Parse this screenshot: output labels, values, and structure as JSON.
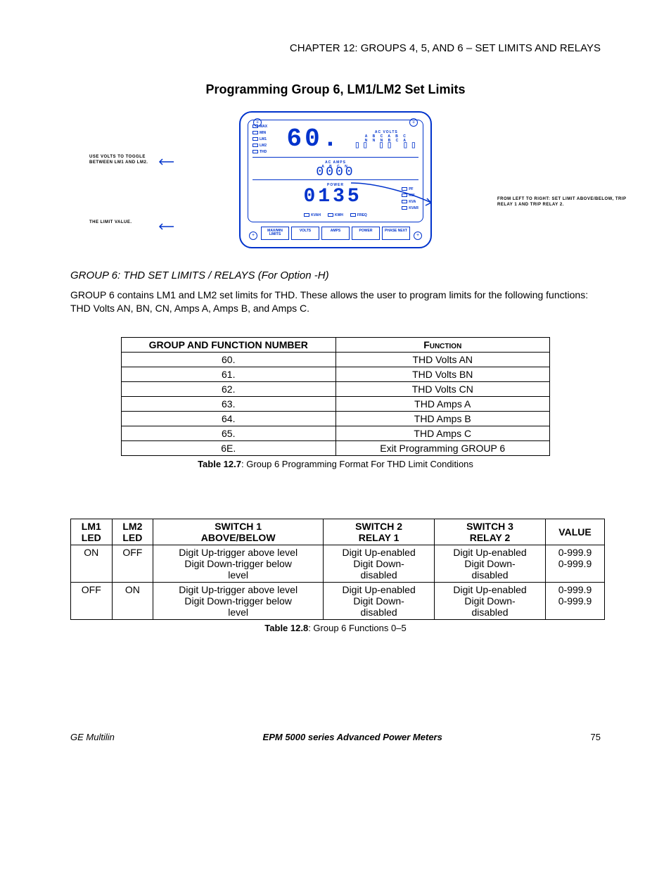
{
  "chapter_header": "CHAPTER 12: GROUPS 4, 5, AND 6 – SET LIMITS AND RELAYS",
  "title": "Programming Group 6, LM1/LM2 Set Limits",
  "figure": {
    "annotations": {
      "left1": "USE VOLTS TO TOGGLE BETWEEN LM1 AND LM2.",
      "left2": "THE LIMIT VALUE.",
      "right1": "FROM LEFT TO RIGHT: SET LIMIT ABOVE/BELOW, TRIP RELAY 1 AND TRIP RELAY 2."
    },
    "leds_left": [
      "MAX",
      "MIN",
      "LM1",
      "LM2",
      "THD"
    ],
    "seg_top": "60.",
    "ac_volts": "AC VOLTS",
    "volts_row": "A B C A B C",
    "volts_nn": "N N N B C A",
    "ac_amps": "AC AMPS",
    "amps_row": "A B C N",
    "amps_val": "0000",
    "power": "POWER",
    "seg_bottom": "0135",
    "power_leds": [
      "PF",
      "KW",
      "KVA",
      "KVAR"
    ],
    "bottom_leds": [
      "KVAH",
      "KWH",
      "FREQ"
    ],
    "buttons": [
      "MAX/MIN LIMITS",
      "VOLTS",
      "AMPS",
      "POWER",
      "PHASE NEXT"
    ]
  },
  "group_heading": "GROUP 6: THD SET LIMITS / RELAYS (For Option -H)",
  "paragraph": "GROUP 6 contains LM1 and LM2 set limits for THD.  These allows the user to program limits for the following functions:  THD Volts AN, BN, CN, Amps A, Amps B, and Amps C.",
  "table1": {
    "headers": [
      "GROUP AND FUNCTION NUMBER",
      "Function"
    ],
    "rows": [
      [
        "60.",
        "THD Volts AN"
      ],
      [
        "61.",
        "THD Volts BN"
      ],
      [
        "62.",
        "THD Volts CN"
      ],
      [
        "63.",
        "THD Amps A"
      ],
      [
        "64.",
        "THD Amps B"
      ],
      [
        "65.",
        "THD Amps C"
      ],
      [
        "6E.",
        "Exit Programming GROUP 6"
      ]
    ],
    "caption_bold": "Table 12.7",
    "caption_rest": ": Group 6 Programming Format For THD Limit Conditions"
  },
  "table2": {
    "headers": [
      "LM1 LED",
      "LM2 LED",
      "SWITCH 1 ABOVE/BELOW",
      "SWITCH 2 RELAY 1",
      "SWITCH 3 RELAY 2",
      "VALUE"
    ],
    "rows": [
      [
        "ON",
        "OFF",
        "Digit Up-trigger above level Digit Down-trigger below level",
        "Digit Up-enabled Digit Down-disabled",
        "Digit Up-enabled Digit Down-disabled",
        "0-999.9 0-999.9"
      ],
      [
        "OFF",
        "ON",
        "Digit Up-trigger above level Digit Down-trigger below level",
        "Digit Up-enabled Digit Down-disabled",
        "Digit Up-enabled Digit Down-disabled",
        "0-999.9 0-999.9"
      ]
    ],
    "caption_bold": "Table 12.8",
    "caption_rest": ": Group 6 Functions 0–5"
  },
  "footer": {
    "left": "GE Multilin",
    "mid": "EPM 5000 series Advanced Power Meters",
    "page": "75"
  }
}
